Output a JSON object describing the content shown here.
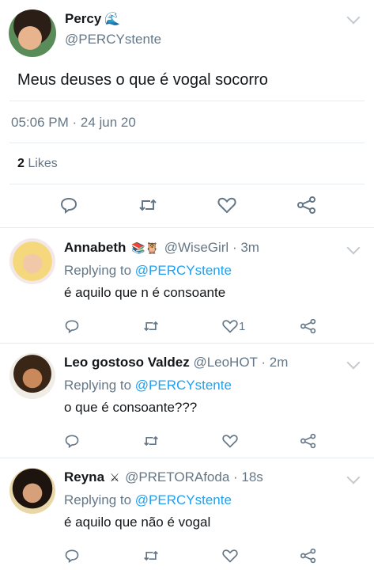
{
  "main_tweet": {
    "name": "Percy",
    "name_emoji": "🌊",
    "handle": "@PERCYstente",
    "text": "Meus deuses o que é vogal socorro",
    "timestamp": "05:06 PM · 24 jun 20",
    "likes_count": "2",
    "likes_label": "Likes"
  },
  "replies": [
    {
      "name": "Annabeth",
      "emojis": "📚🦉",
      "handle": "@WiseGirl",
      "time": "· 3m",
      "replying_prefix": "Replying to",
      "replying_to": "@PERCYstente",
      "text": "é aquilo que n é consoante",
      "like_count": "1"
    },
    {
      "name": "Leo gostoso Valdez",
      "emojis": "",
      "handle": "@LeoHOT",
      "time": "· 2m",
      "replying_prefix": "Replying to",
      "replying_to": "@PERCYstente",
      "text": "o que é consoante???",
      "like_count": ""
    },
    {
      "name": "Reyna",
      "emojis": "⚔",
      "handle": "@PRETORAfoda",
      "time": "· 18s",
      "replying_prefix": "Replying to",
      "replying_to": "@PERCYstente",
      "text": "é aquilo que não é vogal",
      "like_count": ""
    }
  ],
  "icons": {
    "reply": "reply-icon",
    "retweet": "retweet-icon",
    "like": "heart-icon",
    "share": "share-icon",
    "more": "chevron-down-icon"
  },
  "colors": {
    "link": "#1da1f2",
    "secondary": "#657786",
    "divider": "#e6ecf0"
  }
}
